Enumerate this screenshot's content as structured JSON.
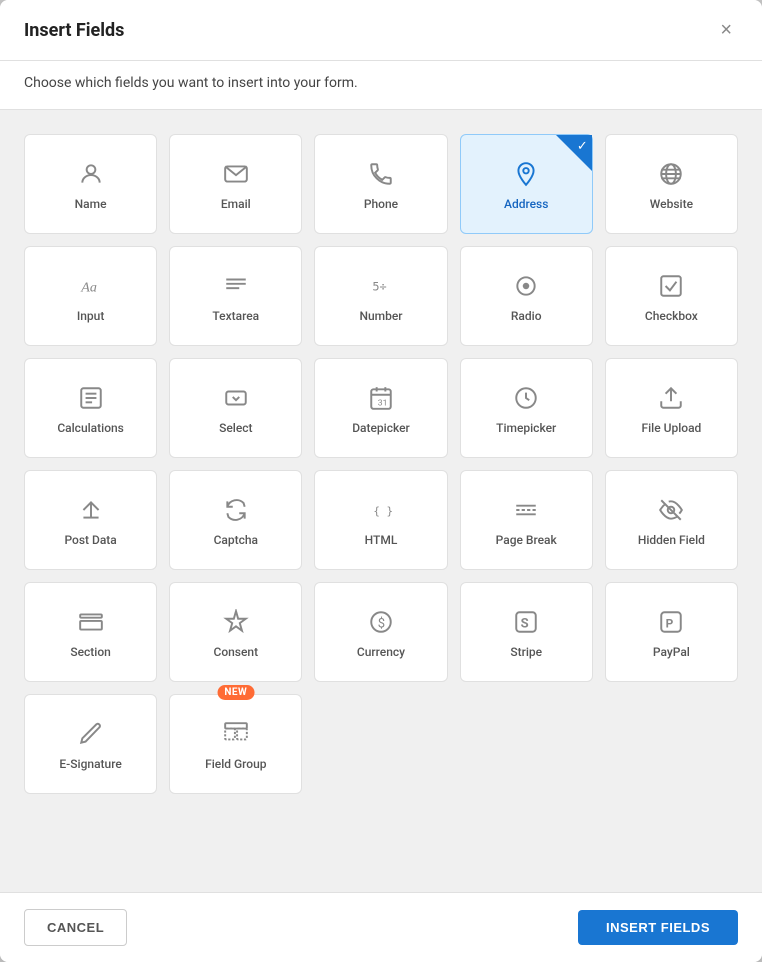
{
  "modal": {
    "title": "Insert Fields",
    "subtitle": "Choose which fields you want to insert into your form.",
    "close_label": "×"
  },
  "footer": {
    "cancel_label": "CANCEL",
    "insert_label": "INSERT FIELDS"
  },
  "fields": [
    {
      "id": "name",
      "label": "Name",
      "icon": "name",
      "selected": false
    },
    {
      "id": "email",
      "label": "Email",
      "icon": "email",
      "selected": false
    },
    {
      "id": "phone",
      "label": "Phone",
      "icon": "phone",
      "selected": false
    },
    {
      "id": "address",
      "label": "Address",
      "icon": "address",
      "selected": true
    },
    {
      "id": "website",
      "label": "Website",
      "icon": "website",
      "selected": false
    },
    {
      "id": "input",
      "label": "Input",
      "icon": "input",
      "selected": false
    },
    {
      "id": "textarea",
      "label": "Textarea",
      "icon": "textarea",
      "selected": false
    },
    {
      "id": "number",
      "label": "Number",
      "icon": "number",
      "selected": false
    },
    {
      "id": "radio",
      "label": "Radio",
      "icon": "radio",
      "selected": false
    },
    {
      "id": "checkbox",
      "label": "Checkbox",
      "icon": "checkbox",
      "selected": false
    },
    {
      "id": "calculations",
      "label": "Calculations",
      "icon": "calc",
      "selected": false
    },
    {
      "id": "select",
      "label": "Select",
      "icon": "select",
      "selected": false
    },
    {
      "id": "datepicker",
      "label": "Datepicker",
      "icon": "date",
      "selected": false
    },
    {
      "id": "timepicker",
      "label": "Timepicker",
      "icon": "time",
      "selected": false
    },
    {
      "id": "fileupload",
      "label": "File Upload",
      "icon": "upload",
      "selected": false
    },
    {
      "id": "postdata",
      "label": "Post Data",
      "icon": "postdata",
      "selected": false
    },
    {
      "id": "captcha",
      "label": "Captcha",
      "icon": "captcha",
      "selected": false
    },
    {
      "id": "html",
      "label": "HTML",
      "icon": "html",
      "selected": false
    },
    {
      "id": "pagebreak",
      "label": "Page Break",
      "icon": "pagebreak",
      "selected": false
    },
    {
      "id": "hiddenfield",
      "label": "Hidden Field",
      "icon": "hidden",
      "selected": false
    },
    {
      "id": "section",
      "label": "Section",
      "icon": "section",
      "selected": false
    },
    {
      "id": "consent",
      "label": "Consent",
      "icon": "consent",
      "selected": false
    },
    {
      "id": "currency",
      "label": "Currency",
      "icon": "currency",
      "selected": false
    },
    {
      "id": "stripe",
      "label": "Stripe",
      "icon": "stripe",
      "selected": false
    },
    {
      "id": "paypal",
      "label": "PayPal",
      "icon": "paypal",
      "selected": false
    },
    {
      "id": "esignature",
      "label": "E-Signature",
      "icon": "esig",
      "selected": false
    },
    {
      "id": "fieldgroup",
      "label": "Field Group",
      "icon": "fieldgroup",
      "selected": false,
      "isNew": true
    }
  ]
}
